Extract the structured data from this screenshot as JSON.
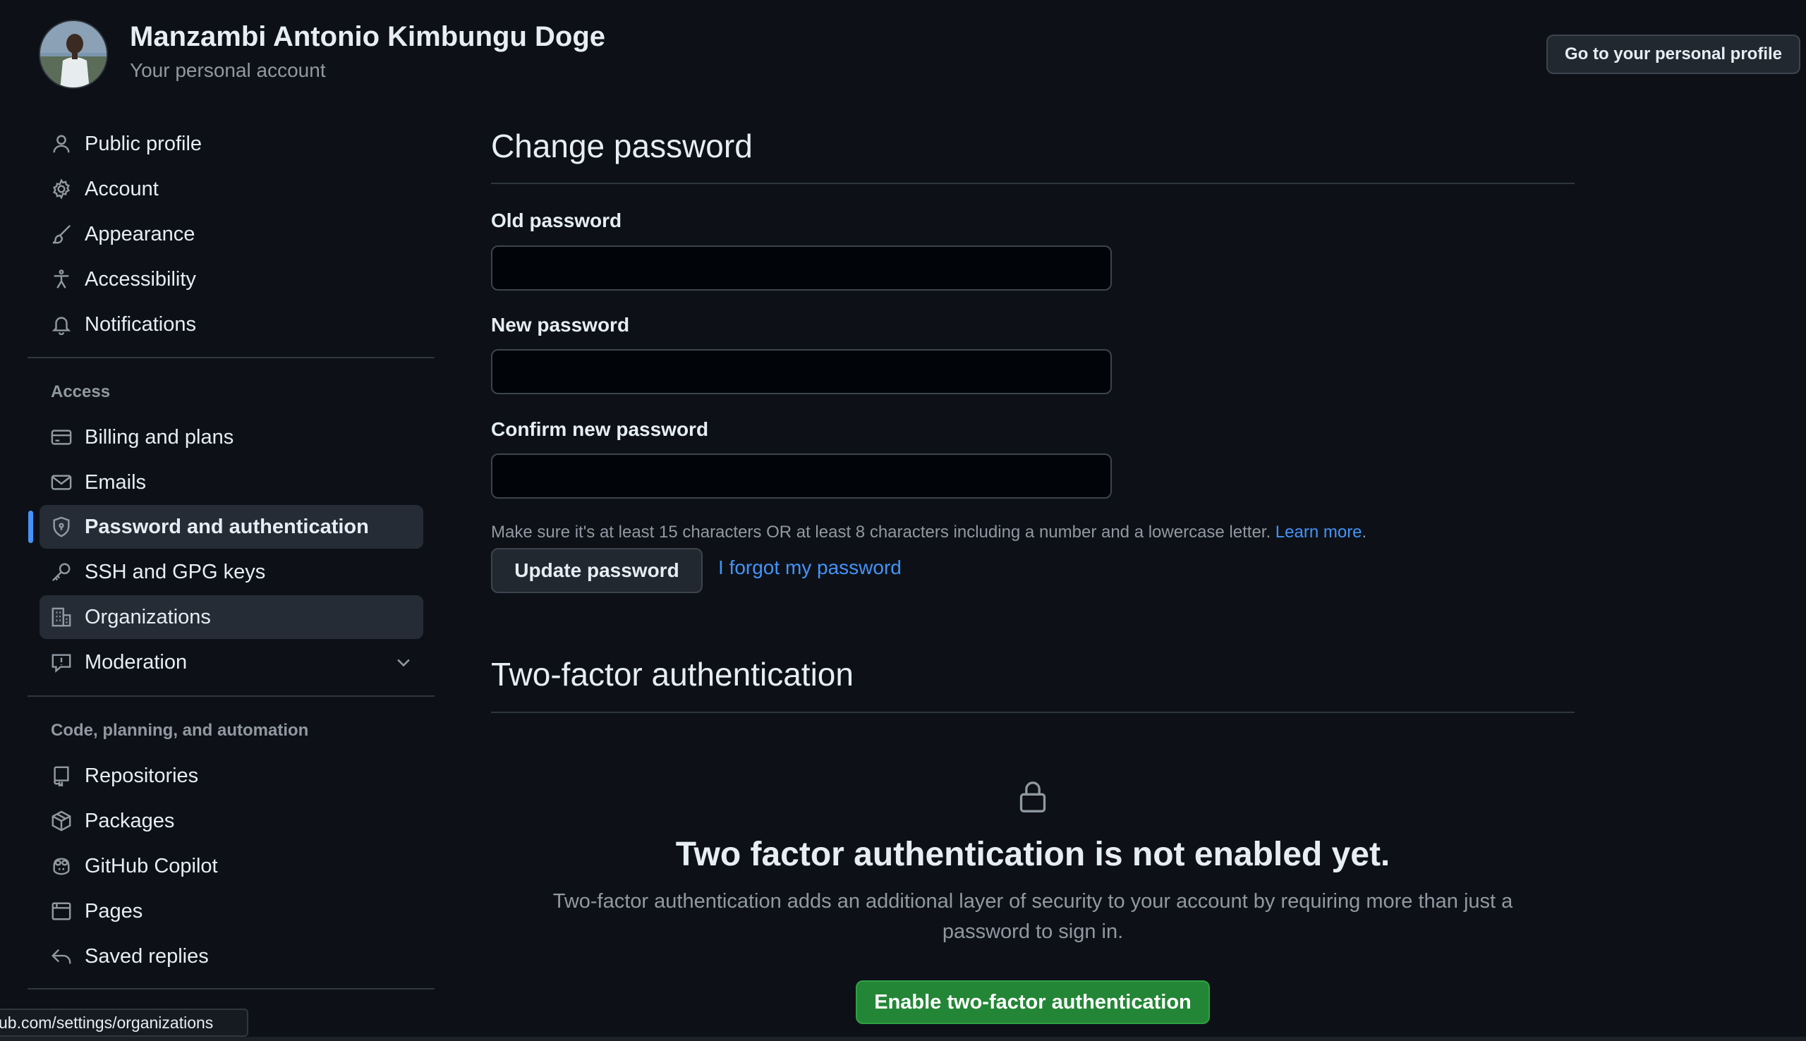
{
  "header": {
    "account_name": "Manzambi Antonio Kimbungu Doge",
    "account_subtitle": "Your personal account",
    "profile_button": "Go to your personal profile"
  },
  "sidebar": {
    "items": [
      {
        "label": "Public profile",
        "icon": "person-icon"
      },
      {
        "label": "Account",
        "icon": "gear-icon"
      },
      {
        "label": "Appearance",
        "icon": "paintbrush-icon"
      },
      {
        "label": "Accessibility",
        "icon": "accessibility-icon"
      },
      {
        "label": "Notifications",
        "icon": "bell-icon"
      }
    ],
    "access_heading": "Access",
    "access_items": [
      {
        "label": "Billing and plans",
        "icon": "credit-card-icon"
      },
      {
        "label": "Emails",
        "icon": "mail-icon"
      },
      {
        "label": "Password and authentication",
        "icon": "shield-lock-icon",
        "active": true
      },
      {
        "label": "SSH and GPG keys",
        "icon": "key-icon"
      },
      {
        "label": "Organizations",
        "icon": "organization-icon"
      },
      {
        "label": "Moderation",
        "icon": "report-icon"
      }
    ],
    "code_heading": "Code, planning, and automation",
    "code_items": [
      {
        "label": "Repositories",
        "icon": "repo-icon"
      },
      {
        "label": "Packages",
        "icon": "package-icon"
      },
      {
        "label": "GitHub Copilot",
        "icon": "copilot-icon"
      },
      {
        "label": "Pages",
        "icon": "browser-icon"
      },
      {
        "label": "Saved replies",
        "icon": "reply-icon"
      }
    ]
  },
  "change_password": {
    "title": "Change password",
    "old_label": "Old password",
    "new_label": "New password",
    "confirm_label": "Confirm new password",
    "old_value": "",
    "new_value": "",
    "confirm_value": "",
    "hint": "Make sure it's at least 15 characters OR at least 8 characters including a number and a lowercase letter.",
    "learn_more": "Learn more",
    "update_button": "Update password",
    "forgot_link": "I forgot my password"
  },
  "two_factor": {
    "title": "Two-factor authentication",
    "status_title": "Two factor authentication is not enabled yet.",
    "description": "Two-factor authentication adds an additional layer of security to your account by requiring more than just a password to sign in.",
    "enable_button": "Enable two-factor authentication"
  },
  "status_bar": {
    "url": "ub.com/settings/organizations"
  },
  "colors": {
    "background": "#0d1117",
    "accent": "#4493f8",
    "primary_button": "#238636",
    "border": "#30363d",
    "muted_text": "#9198a1"
  }
}
